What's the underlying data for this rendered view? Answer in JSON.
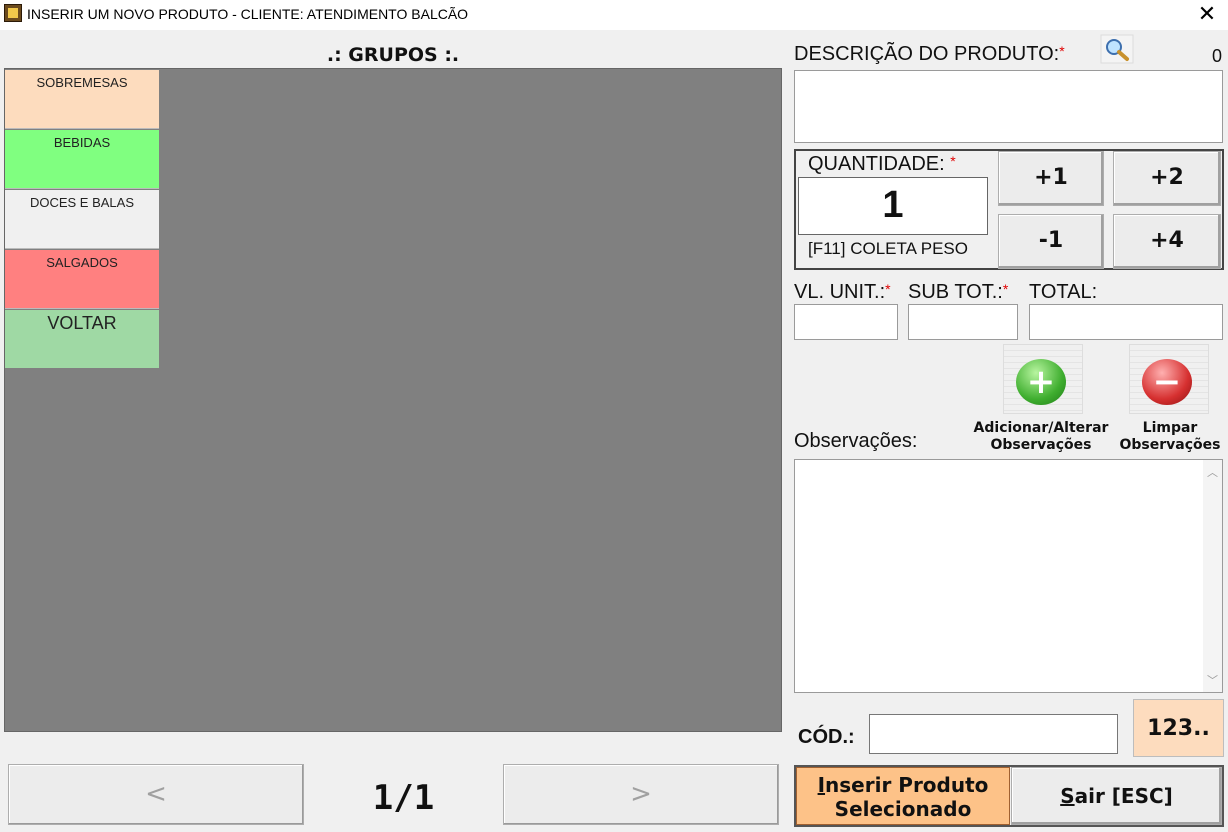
{
  "window": {
    "title": "INSERIR UM NOVO PRODUTO - CLIENTE: ATENDIMENTO BALCÃO",
    "close_glyph": "✕"
  },
  "groups": {
    "title": ".: GRUPOS :.",
    "items": [
      {
        "label": "SOBREMESAS",
        "color": "#fddcbe"
      },
      {
        "label": "BEBIDAS",
        "color": "#80ff80"
      },
      {
        "label": "DOCES E BALAS",
        "color": "#f0f0f0"
      },
      {
        "label": "SALGADOS",
        "color": "#ff8080"
      },
      {
        "label": "VOLTAR",
        "color": "#9fd9a4"
      }
    ],
    "pager": {
      "prev": "<",
      "page": "1/1",
      "next": ">"
    }
  },
  "product": {
    "description_label": "DESCRIÇÃO DO PRODUTO:",
    "required_mark": "*",
    "count": "0",
    "description": ""
  },
  "quantity": {
    "label": "QUANTIDADE:",
    "value": "1",
    "weigh_hint": "[F11] COLETA PESO",
    "buttons": {
      "plus1": "+1",
      "plus2": "+2",
      "minus1": "-1",
      "plus4": "+4"
    }
  },
  "values": {
    "unit_label": "VL. UNIT.:",
    "subtotal_label": "SUB TOT.:",
    "total_label": "TOTAL:",
    "unit": "",
    "subtotal": "",
    "total": ""
  },
  "observations": {
    "label": "Observações:",
    "add_line1": "Adicionar/Alterar",
    "add_line2": "Observações",
    "clear_line1": "Limpar",
    "clear_line2": "Observações",
    "text": ""
  },
  "code": {
    "label": "CÓD.:",
    "value": "",
    "numpad": "123.."
  },
  "actions": {
    "insert_first": "I",
    "insert_rest": "nserir Produto",
    "insert_line2": "Selecionado",
    "exit_first": "S",
    "exit_rest": "air [ESC]"
  },
  "icons": {
    "search": "search-icon",
    "add": "plus-icon",
    "clear": "minus-icon"
  }
}
